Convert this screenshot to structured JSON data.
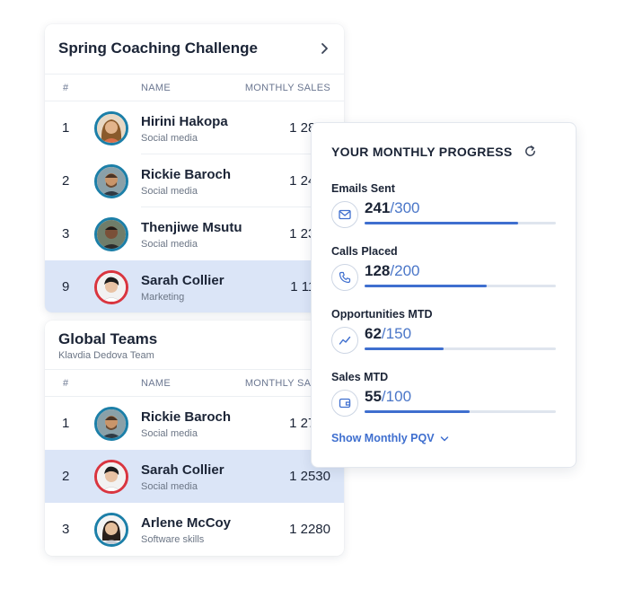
{
  "spring": {
    "title": "Spring Coaching Challenge",
    "columns": {
      "rank": "#",
      "name": "NAME",
      "sales": "MONTHLY SALES"
    },
    "rows": [
      {
        "rank": "1",
        "name": "Hirini Hakopa",
        "sub": "Social media",
        "sales": "1 2830"
      },
      {
        "rank": "2",
        "name": "Rickie Baroch",
        "sub": "Social media",
        "sales": "1 2450"
      },
      {
        "rank": "3",
        "name": "Thenjiwe Msutu",
        "sub": "Social media",
        "sales": "1 2340"
      },
      {
        "rank": "9",
        "name": "Sarah Collier",
        "sub": "Marketing",
        "sales": "1 1100"
      }
    ]
  },
  "global": {
    "title": "Global Teams",
    "subtitle": "Klavdia Dedova Team",
    "columns": {
      "rank": "#",
      "name": "NAME",
      "sales": "MONTHLY SALES"
    },
    "rows": [
      {
        "rank": "1",
        "name": "Rickie Baroch",
        "sub": "Social media",
        "sales": "1 2750"
      },
      {
        "rank": "2",
        "name": "Sarah Collier",
        "sub": "Social media",
        "sales": "1 2530"
      },
      {
        "rank": "3",
        "name": "Arlene McCoy",
        "sub": "Software skills",
        "sales": "1 2280"
      }
    ]
  },
  "progress": {
    "title": "YOUR MONTHLY PROGRESS",
    "metrics": [
      {
        "label": "Emails Sent",
        "current": "241",
        "target": "300",
        "fraction": 0.8033,
        "icon": "mail-icon"
      },
      {
        "label": "Calls Placed",
        "current": "128",
        "target": "200",
        "fraction": 0.64,
        "icon": "phone-icon"
      },
      {
        "label": "Opportunities MTD",
        "current": "62",
        "target": "150",
        "fraction": 0.4133,
        "icon": "trend-icon"
      },
      {
        "label": "Sales MTD",
        "current": "55",
        "target": "100",
        "fraction": 0.55,
        "icon": "wallet-icon"
      }
    ],
    "show_link": "Show Monthly PQV"
  },
  "colors": {
    "accent": "#3f6fcf",
    "highlight_row": "#dbe5f7",
    "avatar_ring": "#1c7fa8",
    "avatar_ring_self": "#d9353f"
  }
}
